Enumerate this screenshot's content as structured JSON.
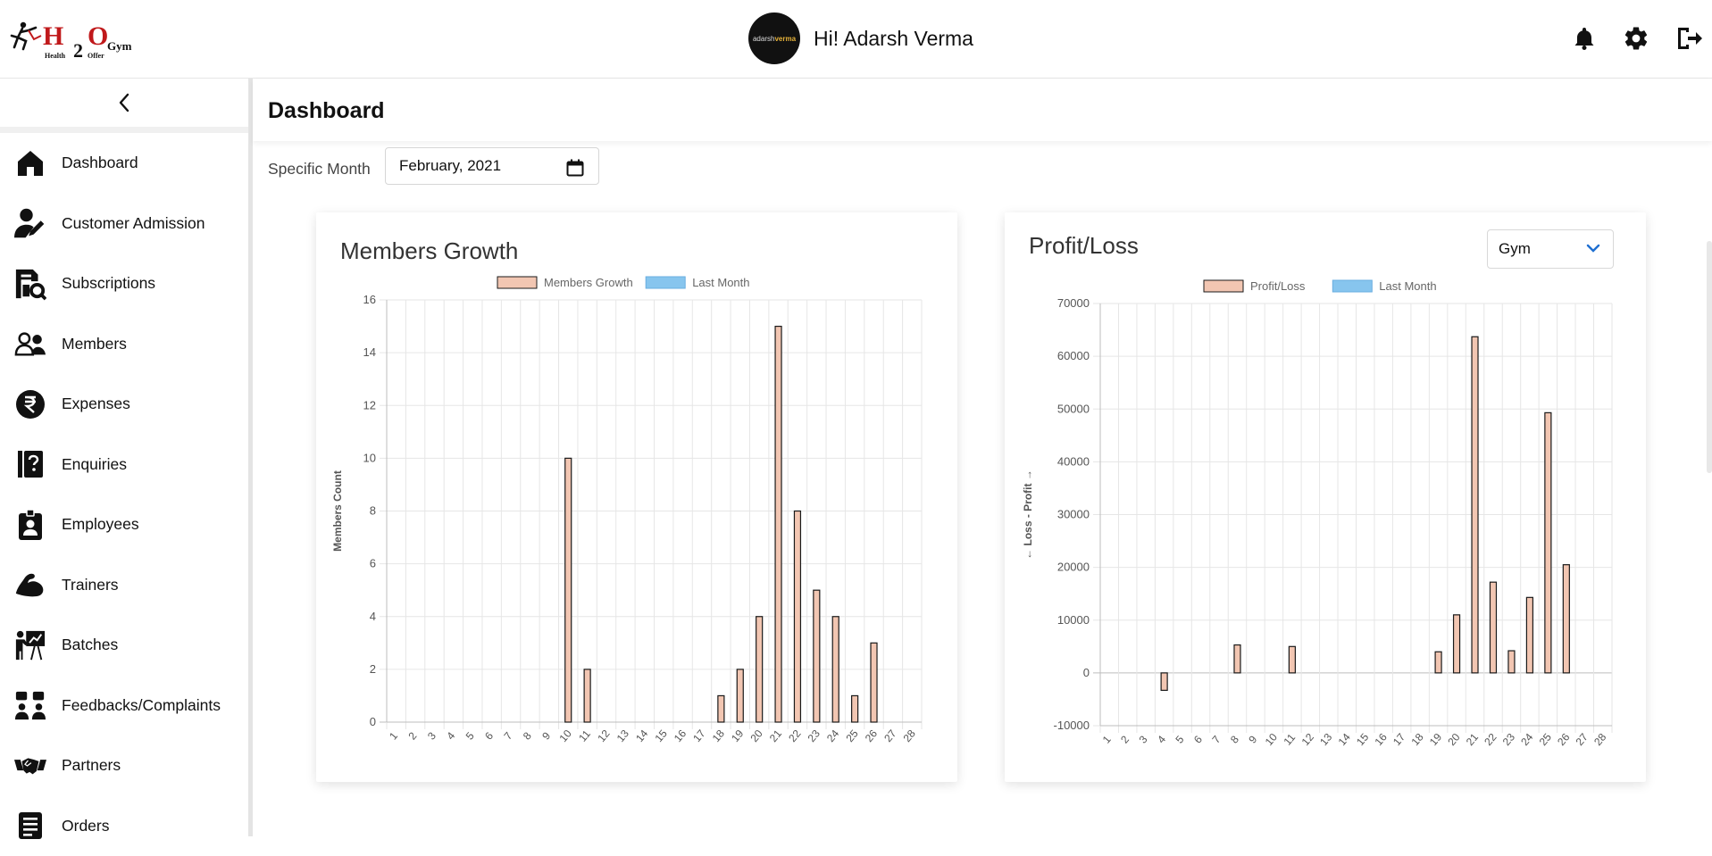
{
  "header": {
    "logo": {
      "h": "H",
      "two": "2",
      "o": "O",
      "gym": "Gym",
      "health": "Health",
      "offer": "Offer"
    },
    "avatar_text_a": "adarsh",
    "avatar_text_b": "verma",
    "greeting": "Hi! Adarsh Verma",
    "icons": [
      "bell-icon",
      "gear-icon",
      "logout-icon"
    ]
  },
  "sidebar": {
    "items": [
      {
        "label": "Dashboard",
        "icon": "home-icon"
      },
      {
        "label": "Customer Admission",
        "icon": "user-edit-icon"
      },
      {
        "label": "Subscriptions",
        "icon": "subscription-search-icon"
      },
      {
        "label": "Members",
        "icon": "users-icon"
      },
      {
        "label": "Expenses",
        "icon": "rupee-icon"
      },
      {
        "label": "Enquiries",
        "icon": "question-book-icon"
      },
      {
        "label": "Employees",
        "icon": "id-badge-icon"
      },
      {
        "label": "Trainers",
        "icon": "muscle-icon"
      },
      {
        "label": "Batches",
        "icon": "presentation-icon"
      },
      {
        "label": "Feedbacks/Complaints",
        "icon": "feedback-icon"
      },
      {
        "label": "Partners",
        "icon": "handshake-icon"
      },
      {
        "label": "Orders",
        "icon": "orders-icon"
      }
    ]
  },
  "main": {
    "title": "Dashboard",
    "filter_label": "Specific Month",
    "month_value": "February, 2021",
    "profit_select": "Gym"
  },
  "colors": {
    "bar_fill": "#f2c6b2",
    "bar_stroke": "#1a1a1a",
    "last_month": "#87c5ee",
    "grid": "#e6e6e6"
  },
  "chart_data": [
    {
      "type": "bar",
      "title": "Members Growth",
      "ylabel": "Members Count",
      "xlabel": "",
      "ylim": [
        0,
        16
      ],
      "yticks": [
        0,
        2,
        4,
        6,
        8,
        10,
        12,
        14,
        16
      ],
      "categories": [
        "1",
        "2",
        "3",
        "4",
        "5",
        "6",
        "7",
        "8",
        "9",
        "10",
        "11",
        "12",
        "13",
        "14",
        "15",
        "16",
        "17",
        "18",
        "19",
        "20",
        "21",
        "22",
        "23",
        "24",
        "25",
        "26",
        "27",
        "28"
      ],
      "series": [
        {
          "name": "Members Growth",
          "values": [
            0,
            0,
            0,
            0,
            0,
            0,
            0,
            0,
            0,
            10,
            2,
            0,
            0,
            0,
            0,
            0,
            0,
            1,
            2,
            4,
            15,
            8,
            5,
            4,
            1,
            3,
            0,
            0
          ]
        },
        {
          "name": "Last Month",
          "values": []
        }
      ],
      "legend": "top",
      "grid": true
    },
    {
      "type": "bar",
      "title": "Profit/Loss",
      "ylabel": "← Loss - Profit →",
      "xlabel": "",
      "ylim": [
        -10000,
        70000
      ],
      "yticks": [
        -10000,
        0,
        10000,
        20000,
        30000,
        40000,
        50000,
        60000,
        70000
      ],
      "categories": [
        "1",
        "2",
        "3",
        "4",
        "5",
        "6",
        "7",
        "8",
        "9",
        "10",
        "11",
        "12",
        "13",
        "14",
        "15",
        "16",
        "17",
        "18",
        "19",
        "20",
        "21",
        "22",
        "23",
        "24",
        "25",
        "26",
        "27",
        "28"
      ],
      "series": [
        {
          "name": "Profit/Loss",
          "values": [
            0,
            0,
            0,
            -3300,
            0,
            0,
            0,
            5300,
            0,
            0,
            5000,
            0,
            0,
            0,
            0,
            0,
            0,
            0,
            4000,
            11000,
            63700,
            17200,
            4200,
            14300,
            49300,
            20500,
            0,
            0
          ]
        },
        {
          "name": "Last Month",
          "values": []
        }
      ],
      "legend": "top",
      "grid": true
    }
  ]
}
